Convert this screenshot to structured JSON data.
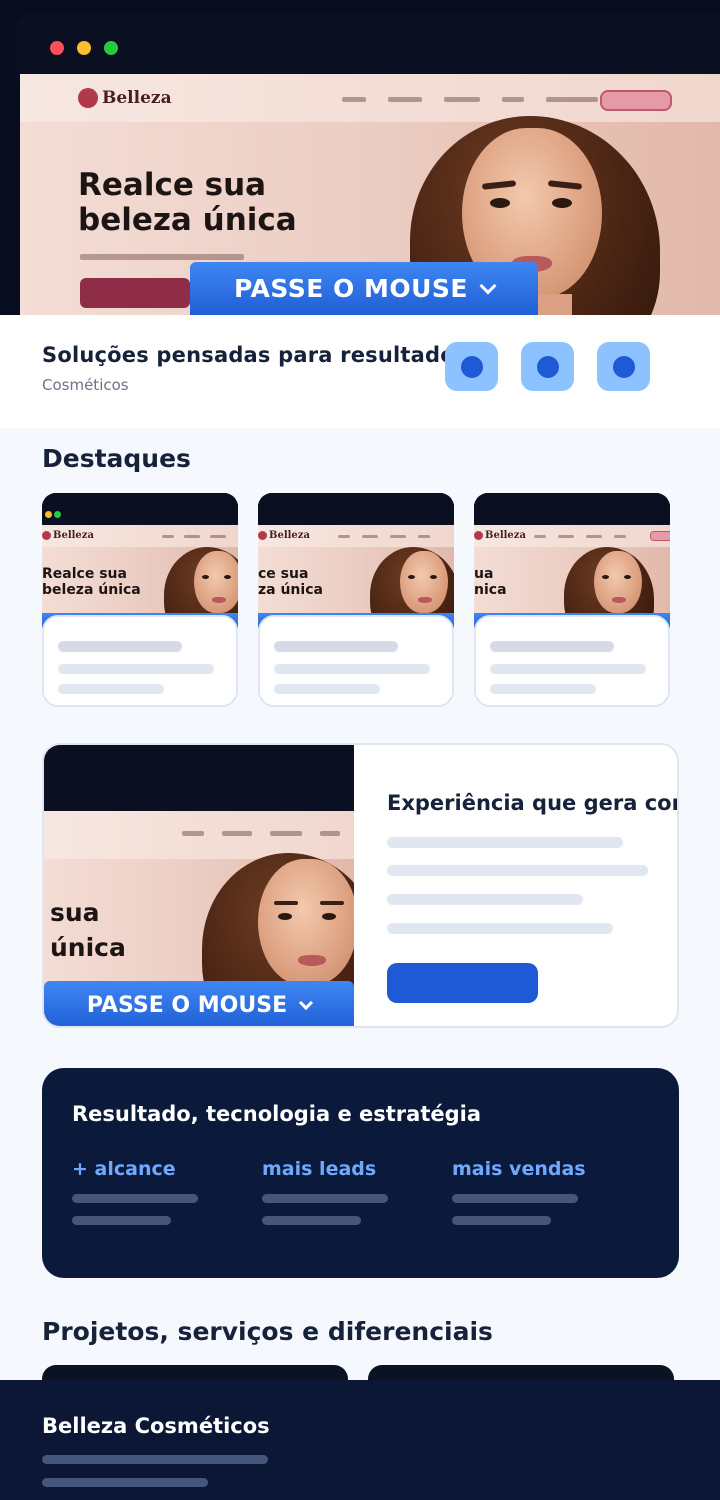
{
  "hero": {
    "logo": "Belleza",
    "headline_1": "Realce sua",
    "headline_2": "beleza única",
    "hover_label": "PASSE O MOUSE"
  },
  "intro": {
    "title": "Soluções pensadas para resultados",
    "subtitle": "Cosméticos"
  },
  "highlights": {
    "heading": "Destaques",
    "cards": [
      {
        "logo": "Belleza",
        "headline_1": "Realce sua",
        "headline_2": "beleza única"
      },
      {
        "logo": "Belleza",
        "headline_1": "ce sua",
        "headline_2": "za única"
      },
      {
        "logo": "Belleza",
        "headline_1": "ua",
        "headline_2": "nica"
      }
    ]
  },
  "feature": {
    "title": "Experiência que gera confiança",
    "headline_1": "sua",
    "headline_2": "única",
    "hover_label": "PASSE O MOUSE"
  },
  "stats": {
    "title": "Resultado, tecnologia e estratégia",
    "items": [
      {
        "label": "+ alcance"
      },
      {
        "label": "mais leads"
      },
      {
        "label": "mais vendas"
      }
    ]
  },
  "projects": {
    "heading": "Projetos, serviços e diferenciais"
  },
  "footer": {
    "brand": "Belleza Cosméticos"
  },
  "colors": {
    "accent": "#1f5ad6",
    "accent_light": "#8cc2ff",
    "navy": "#0b1a3b",
    "stat_label": "#6fa9ff"
  }
}
